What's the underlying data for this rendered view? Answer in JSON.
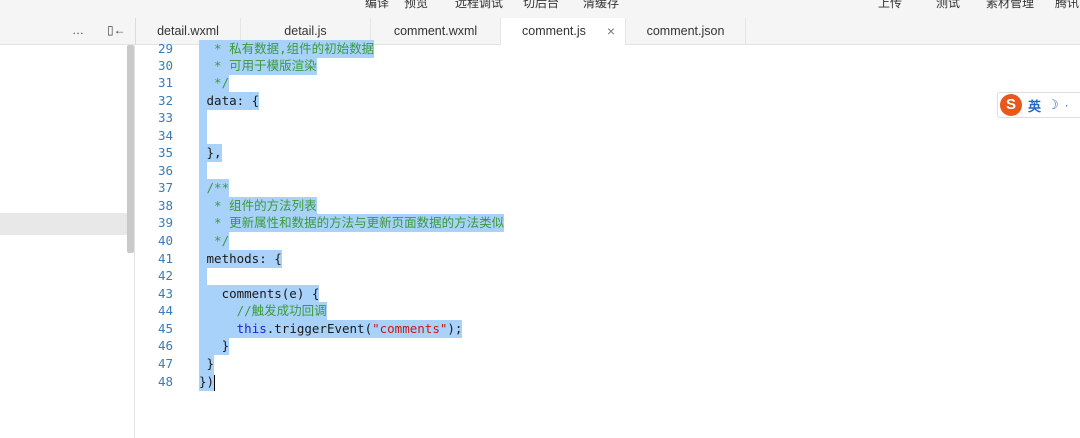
{
  "toolbar": {
    "items": [
      "编译",
      "预览",
      "远程调试",
      "切后台",
      "清缓存",
      "上传",
      "测试",
      "素材管理",
      "腾讯"
    ]
  },
  "tabbar": {
    "more_icon": "…",
    "collapse_icon": "▯←",
    "tabs": [
      {
        "label": "detail.wxml",
        "active": false
      },
      {
        "label": "detail.js",
        "active": false
      },
      {
        "label": "comment.wxml",
        "active": false
      },
      {
        "label": "comment.js",
        "active": true,
        "close": "×"
      },
      {
        "label": "comment.json",
        "active": false
      }
    ]
  },
  "ime": {
    "logo": "S",
    "text": "英",
    "moon": "☽",
    "dot": "·"
  },
  "editor": {
    "lines": [
      {
        "n": "29",
        "text": "  * 私有数据,组件的初始数据"
      },
      {
        "n": "30",
        "text": "  * 可用于模版渲染"
      },
      {
        "n": "31",
        "text": "  */"
      },
      {
        "n": "32",
        "text": " data: {"
      },
      {
        "n": "33",
        "text": ""
      },
      {
        "n": "34",
        "text": ""
      },
      {
        "n": "35",
        "text": " },"
      },
      {
        "n": "36",
        "text": ""
      },
      {
        "n": "37",
        "text": " /**"
      },
      {
        "n": "38",
        "text": "  * 组件的方法列表"
      },
      {
        "n": "39",
        "text": "  * 更新属性和数据的方法与更新页面数据的方法类似"
      },
      {
        "n": "40",
        "text": "  */"
      },
      {
        "n": "41",
        "text": " methods: {"
      },
      {
        "n": "42",
        "text": ""
      },
      {
        "n": "43",
        "text": "   comments(e) {"
      },
      {
        "n": "44",
        "text": "     //触发成功回调"
      },
      {
        "n": "45",
        "text": "     this.triggerEvent(\"comments\");"
      },
      {
        "n": "46",
        "text": "   }"
      },
      {
        "n": "47",
        "text": " }"
      },
      {
        "n": "48",
        "text": "})"
      }
    ]
  },
  "colors": {
    "selection": "#a9d2fb",
    "comment": "#3a9a3a",
    "keyword": "#1f1fd0",
    "string": "#c41a16",
    "line_number": "#3a7bb8"
  }
}
